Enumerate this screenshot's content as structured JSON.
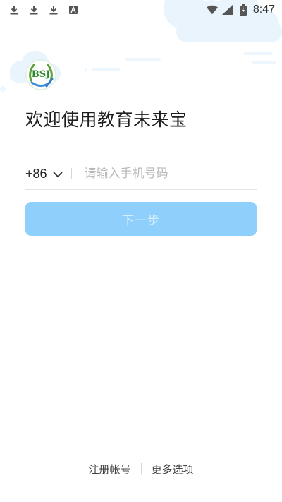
{
  "status_bar": {
    "time": "8:47",
    "left_icons": [
      "download-icon",
      "download-icon",
      "download-icon",
      "a-icon"
    ],
    "right_icons": [
      "wifi-icon",
      "signal-icon",
      "battery-charging-icon"
    ]
  },
  "logo": {
    "icon": "bsj-logo-icon"
  },
  "welcome": {
    "title": "欢迎使用教育未来宝"
  },
  "login": {
    "country_code": "+86",
    "phone_placeholder": "请输入手机号码",
    "next_label": "下一步"
  },
  "footer": {
    "register_label": "注册帐号",
    "more_options_label": "更多选项"
  },
  "colors": {
    "accent": "#8ed0fb",
    "cloud": "#e8f3fd"
  }
}
